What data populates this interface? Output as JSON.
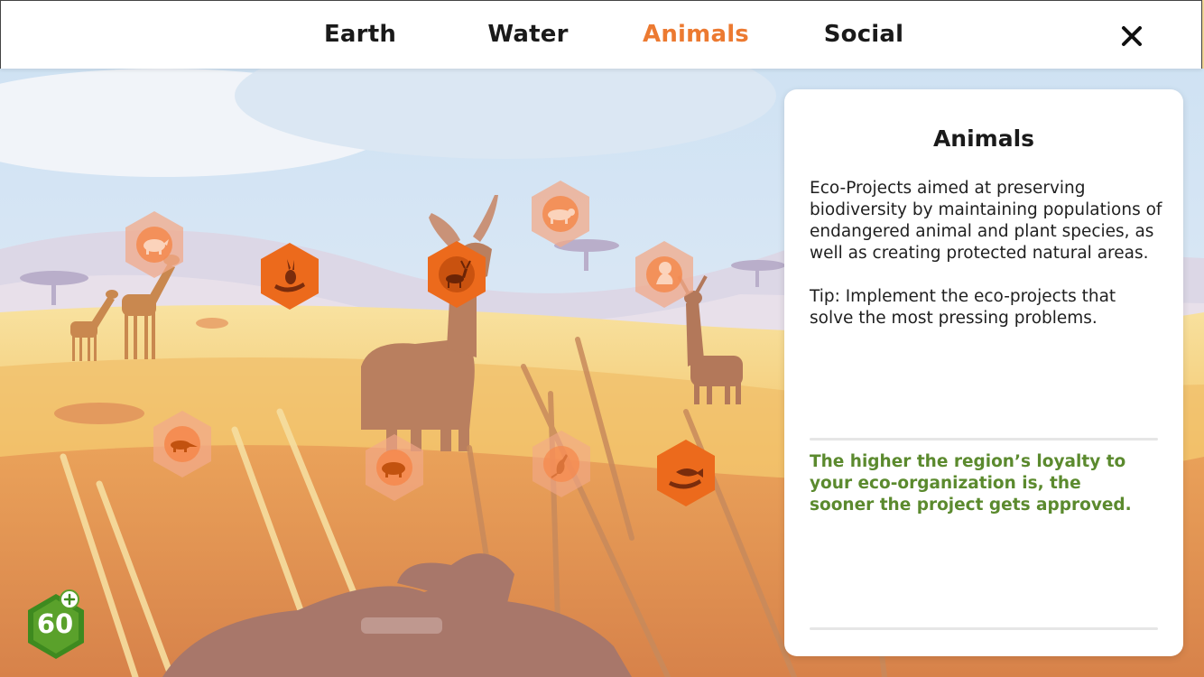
{
  "tabs": [
    {
      "label": "Earth",
      "active": false
    },
    {
      "label": "Water",
      "active": false
    },
    {
      "label": "Animals",
      "active": true
    },
    {
      "label": "Social",
      "active": false
    }
  ],
  "colors": {
    "active_tab": "#ec7a31",
    "inactive_tab": "#1a1a1a",
    "project_active": "#ec6a1c",
    "project_inactive": "#f2a98a",
    "note_text": "#5b8a2e",
    "badge": "#5aa12b"
  },
  "projects": [
    {
      "name": "rhino-project",
      "icon": "rhino-icon",
      "state": "inactive"
    },
    {
      "name": "hare-hand-project",
      "icon": "hare-in-hand-icon",
      "state": "active"
    },
    {
      "name": "deer-project",
      "icon": "deer-icon",
      "state": "active"
    },
    {
      "name": "tiger-project",
      "icon": "tiger-icon",
      "state": "inactive"
    },
    {
      "name": "seal-project",
      "icon": "seal-icon",
      "state": "inactive"
    },
    {
      "name": "anteater-project",
      "icon": "anteater-icon",
      "state": "inactive"
    },
    {
      "name": "hippo-project",
      "icon": "hippo-icon",
      "state": "inactive"
    },
    {
      "name": "kangaroo-project",
      "icon": "kangaroo-icon",
      "state": "inactive"
    },
    {
      "name": "fish-hand-project",
      "icon": "fish-in-hand-icon",
      "state": "active"
    }
  ],
  "panel": {
    "title": "Animals",
    "description": "Eco-Projects aimed at preserving biodiversity by maintaining populations of endangered animal and plant species, as well as creating protected natural areas.",
    "tip": "Tip: Implement the eco-projects that solve the most pressing problems.",
    "note": "The higher the region’s loyalty to your eco-organization is, the sooner the project gets approved."
  },
  "points": {
    "value": "60",
    "icon": "plus-icon"
  }
}
